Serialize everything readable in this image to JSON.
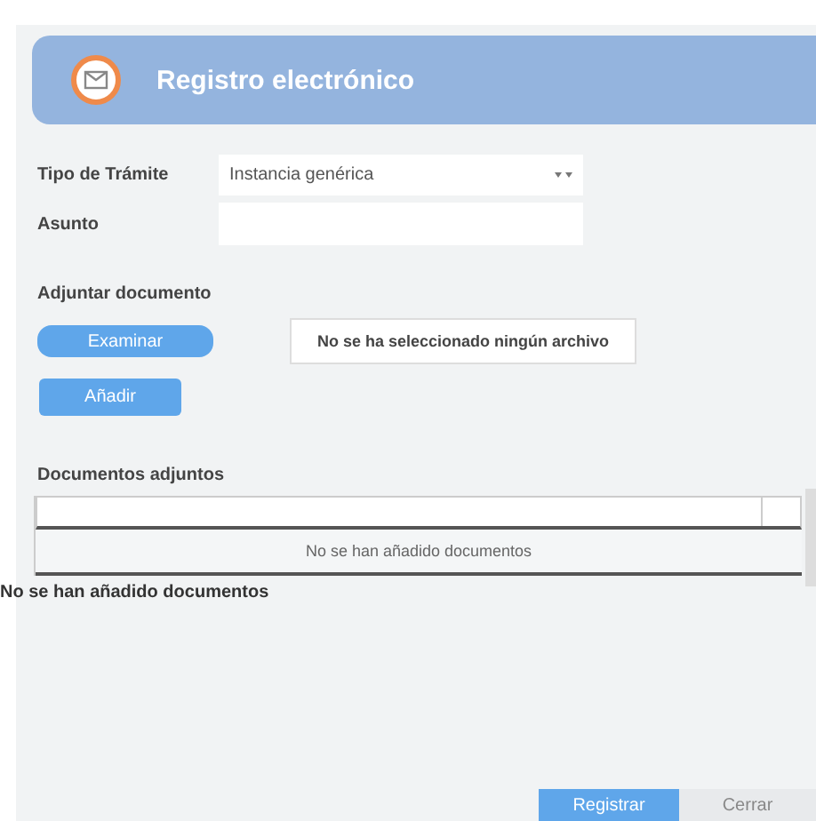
{
  "header": {
    "title": "Registro electrónico"
  },
  "form": {
    "fields": [
      {
        "kind": "select",
        "label": "Tipo de Trámite",
        "value": "Instancia genérica"
      },
      {
        "kind": "text",
        "label": "Asunto"
      }
    ]
  },
  "attach": {
    "label": "Adjuntar documento",
    "browse_button": "Examinar",
    "file_status": "No se ha seleccionado ningún archivo",
    "add_button": "Añadir"
  },
  "documents": {
    "label": "Documentos adjuntos",
    "empty_row": "No se han añadido documentos",
    "summary": "No se han añadido documentos"
  },
  "buttons": [
    {
      "label": "Registrar",
      "kind": "primary"
    },
    {
      "label": "Cerrar",
      "kind": "secondary"
    }
  ]
}
